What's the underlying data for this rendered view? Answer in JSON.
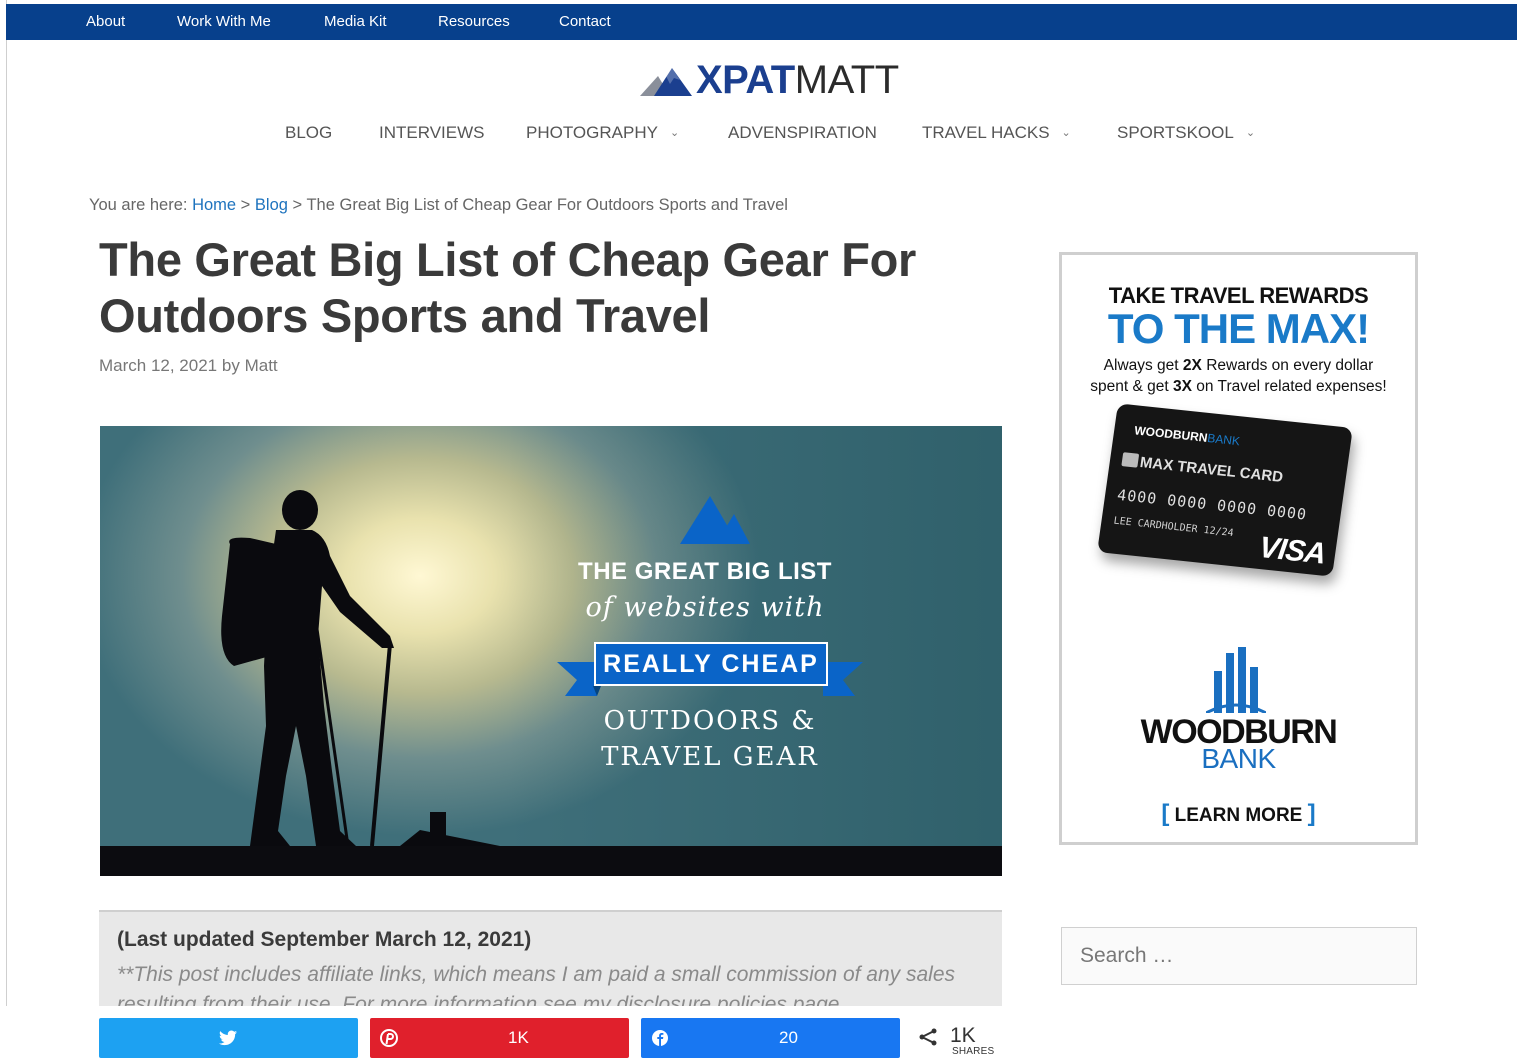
{
  "topbar": {
    "links": [
      "About",
      "Work With Me",
      "Media Kit",
      "Resources",
      "Contact"
    ]
  },
  "logo": {
    "part1": "XPAT",
    "part2": "MATT"
  },
  "nav": {
    "items": [
      {
        "label": "BLOG",
        "has_dropdown": false
      },
      {
        "label": "INTERVIEWS",
        "has_dropdown": false
      },
      {
        "label": "PHOTOGRAPHY",
        "has_dropdown": true
      },
      {
        "label": "ADVENSPIRATION",
        "has_dropdown": false
      },
      {
        "label": "TRAVEL HACKS",
        "has_dropdown": true
      },
      {
        "label": "SPORTSKOOL",
        "has_dropdown": true
      }
    ],
    "chevron": "⌄"
  },
  "breadcrumb": {
    "prefix": "You are here:",
    "home": "Home",
    "sep": ">",
    "blog": "Blog",
    "current": "The Great Big List of Cheap Gear For Outdoors Sports and Travel"
  },
  "post": {
    "title": "The Great Big List of Cheap Gear For Outdoors Sports and Travel",
    "date": "March 12, 2021",
    "by": "by",
    "author": "Matt"
  },
  "hero": {
    "line1": "THE GREAT BIG LIST",
    "line2": "of websites with",
    "banner": "REALLY CHEAP",
    "line3": "OUTDOORS &",
    "line4": "TRAVEL GEAR",
    "colors": {
      "banner": "#0a64c8"
    }
  },
  "update_box": {
    "heading": "(Last updated September March 12, 2021)",
    "text": "**This post includes affiliate links, which means I am paid a small commission of any sales resulting from their use. For more information see my disclosure policies page."
  },
  "share": {
    "twitter": {
      "icon": "twitter-icon",
      "glyph": "🐦",
      "color": "#1da1f2"
    },
    "pinterest": {
      "icon": "pinterest-icon",
      "glyph": "℗",
      "count": "1K",
      "color": "#e0202c"
    },
    "facebook": {
      "icon": "facebook-icon",
      "glyph": "f",
      "count": "20",
      "color": "#1877f2"
    },
    "total": "1K",
    "total_label": "SHARES",
    "share_glyph": "<"
  },
  "ad": {
    "line1": "TAKE TRAVEL REWARDS",
    "line2": "TO THE MAX!",
    "line3a_pre": "Always get ",
    "line3a_bold": "2X",
    "line3a_post": " Rewards on every dollar",
    "line3b_pre": "spent & get ",
    "line3b_bold": "3X",
    "line3b_post": " on Travel related expenses!",
    "card_brand": "WOODBURN",
    "card_brand2": "BANK",
    "card_title": "MAX TRAVEL CARD",
    "card_number": "4000 0000 0000 0000",
    "card_exp": "12/24",
    "card_holder": "LEE CARDHOLDER",
    "card_network": "VISA",
    "bank_name1": "WOODBURN",
    "bank_name2": "BANK",
    "cta": "LEARN MORE",
    "cta_left": "[",
    "cta_right": "]"
  },
  "search": {
    "placeholder": "Search …"
  }
}
